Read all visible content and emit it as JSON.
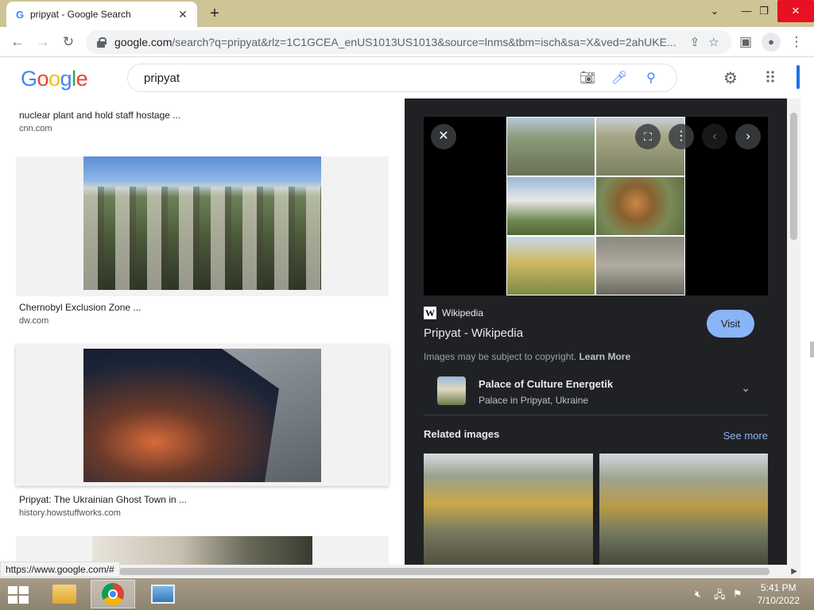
{
  "browser": {
    "tab_title": "pripyat - Google Search",
    "tab_favicon": "G",
    "tab_close": "✕",
    "new_tab": "+",
    "url_host": "google.com",
    "url_rest": "/search?q=pripyat&rlz=1C1GCEA_enUS1013US1013&source=lnms&tbm=isch&sa=X&ved=2ahUKE...",
    "status_url": "https://www.google.com/#"
  },
  "google": {
    "logo": [
      "G",
      "o",
      "o",
      "g",
      "l",
      "e"
    ],
    "logo_colors": [
      "#4285f4",
      "#ea4335",
      "#fbbc05",
      "#4285f4",
      "#34a853",
      "#ea4335"
    ],
    "query": "pripyat"
  },
  "results": [
    {
      "title": "nuclear plant and hold staff hostage ...",
      "source": "cnn.com"
    },
    {
      "title": "Chernobyl Exclusion Zone ...",
      "source": "dw.com"
    },
    {
      "title": "Pripyat: The Ukrainian Ghost Town in ...",
      "source": "history.howstuffworks.com"
    }
  ],
  "panel": {
    "source_logo": "W",
    "source_name": "Wikipedia",
    "title": "Pripyat - Wikipedia",
    "visit": "Visit",
    "copyright": "Images may be subject to copyright.",
    "learn_more": "Learn More",
    "kp_title": "Palace of Culture Energetik",
    "kp_subtitle": "Palace in Pripyat, Ukraine",
    "related_heading": "Related images",
    "see_more": "See more"
  },
  "taskbar": {
    "time": "5:41 PM",
    "date": "7/10/2022"
  },
  "colors": {
    "tabstrip": "#cfc496",
    "panel_bg": "#202124",
    "accent_blue": "#8ab4f8"
  }
}
